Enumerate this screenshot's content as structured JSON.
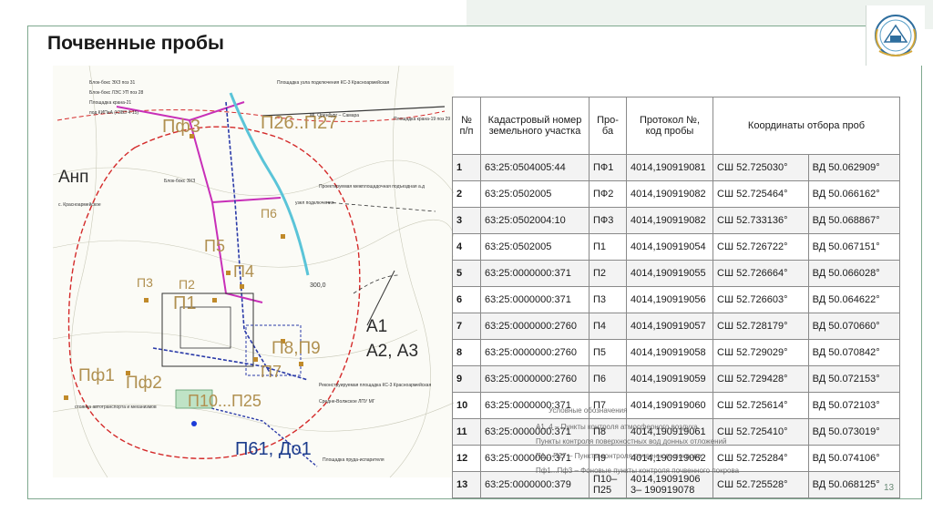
{
  "slide": {
    "title": "Почвенные пробы",
    "page_number": "13"
  },
  "table": {
    "headers": [
      "№ п/п",
      "Кадастровый номер земельного участка",
      "Про-ба",
      "Протокол №, код пробы",
      "Координаты отбора проб"
    ],
    "rows": [
      {
        "n": "1",
        "cad": "63:25:0504005:44",
        "probe": "ПФ1",
        "protocol": "4014,190919081",
        "lat": "СШ 52.725030°",
        "lon": "ВД 50.062909°"
      },
      {
        "n": "2",
        "cad": "63:25:0502005",
        "probe": "ПФ2",
        "protocol": "4014,190919082",
        "lat": "СШ 52.725464°",
        "lon": "ВД 50.066162°"
      },
      {
        "n": "3",
        "cad": "63:25:0502004:10",
        "probe": "ПФ3",
        "protocol": "4014,190919082",
        "lat": "СШ 52.733136°",
        "lon": "ВД 50.068867°"
      },
      {
        "n": "4",
        "cad": "63:25:0502005",
        "probe": "П1",
        "protocol": "4014,190919054",
        "lat": "СШ 52.726722°",
        "lon": "ВД 50.067151°"
      },
      {
        "n": "5",
        "cad": "63:25:0000000:371",
        "probe": "П2",
        "protocol": "4014,190919055",
        "lat": "СШ 52.726664°",
        "lon": "ВД 50.066028°"
      },
      {
        "n": "6",
        "cad": "63:25:0000000:371",
        "probe": "П3",
        "protocol": "4014,190919056",
        "lat": "СШ 52.726603°",
        "lon": "ВД 50.064622°"
      },
      {
        "n": "7",
        "cad": "63:25:0000000:2760",
        "probe": "П4",
        "protocol": "4014,190919057",
        "lat": "СШ 52.728179°",
        "lon": "ВД 50.070660°"
      },
      {
        "n": "8",
        "cad": "63:25:0000000:2760",
        "probe": "П5",
        "protocol": "4014,190919058",
        "lat": "СШ 52.729029°",
        "lon": "ВД 50.070842°"
      },
      {
        "n": "9",
        "cad": "63:25:0000000:2760",
        "probe": "П6",
        "protocol": "4014,190919059",
        "lat": "СШ 52.729428°",
        "lon": "ВД 50.072153°"
      },
      {
        "n": "10",
        "cad": "63:25:0000000:371",
        "probe": "П7",
        "protocol": "4014,190919060",
        "lat": "СШ 52.725614°",
        "lon": "ВД 50.072103°"
      },
      {
        "n": "11",
        "cad": "63:25:0000000:371",
        "probe": "П8",
        "protocol": "4014,190919061",
        "lat": "СШ 52.725410°",
        "lon": "ВД 50.073019°"
      },
      {
        "n": "12",
        "cad": "63:25:0000000:371",
        "probe": "П9",
        "protocol": "4014,190919062",
        "lat": "СШ 52.725284°",
        "lon": "ВД 50.074106°"
      },
      {
        "n": "13",
        "cad": "63:25:0000000:379",
        "probe": "П10–П25",
        "protocol": "4014,19091906 3– 190919078",
        "lat": "СШ 52.725528°",
        "lon": "ВД 50.068125°"
      }
    ]
  },
  "map": {
    "labels": {
      "pf3": "Пф3",
      "p26p27": "П26..П27",
      "anp": "Анп",
      "p6": "П6",
      "p5": "П5",
      "p4": "П4",
      "p1": "П1",
      "p3": "П3",
      "p2": "П2",
      "a1": "А1",
      "a2a3": "А2, А3",
      "p8p9": "П8,П9",
      "p7": "П7",
      "pf1": "Пф1",
      "pf2": "Пф2",
      "p10p25": "П10...П25",
      "p61do1": "П61, До1",
      "dist": "300,0"
    },
    "notes": {
      "n1": "Блок-бокс ЭХЗ поз 31",
      "n2": "Блок-бокс ЛЭС УП поз 28",
      "n3": "Площадка крана-21",
      "n4": "под КИПиА (КЗВЗ 4-15)",
      "n5": "Площадка узла подключения КС-3 Красноармейская",
      "n6": "МГ Оренбург – Самара",
      "n7": "Площадка крана-19 поз 29",
      "n8": "Проектируемая межплощадочная подъездная а.д",
      "n9": "узел подключения",
      "n10": "Блок-бокс ЭХЗ",
      "n11": "с. Красноармейское",
      "n12": "Реконструируемая площадка КС-3 Красноармейская",
      "n13": "Средне-Волжское ЛПУ МГ",
      "n14": "стоянка автотранспорта и механизмов",
      "n15": "Площадка пруда-испарителя"
    }
  },
  "legend": {
    "l1": "Условные обозначения",
    "l2": "А1..4 – Пункты контроля атмосферного воздуха",
    "l3": "Пункты контроля поверхностных вод донных отложений",
    "l4": "П1... П27 – Пункты контроля почвенного покрова",
    "l5": "Пф1...Пф3 – Фоновые пункты контроля почвенного покрова"
  },
  "colors": {
    "frame": "#7ea88e",
    "label_gold": "#b09050",
    "label_blue": "#1c3c8c",
    "boundary_red": "#d42a2a",
    "pipeline_magenta": "#c82fb8",
    "road_blue": "#2a3aa8"
  },
  "icons": {
    "logo": "university-emblem-icon"
  }
}
